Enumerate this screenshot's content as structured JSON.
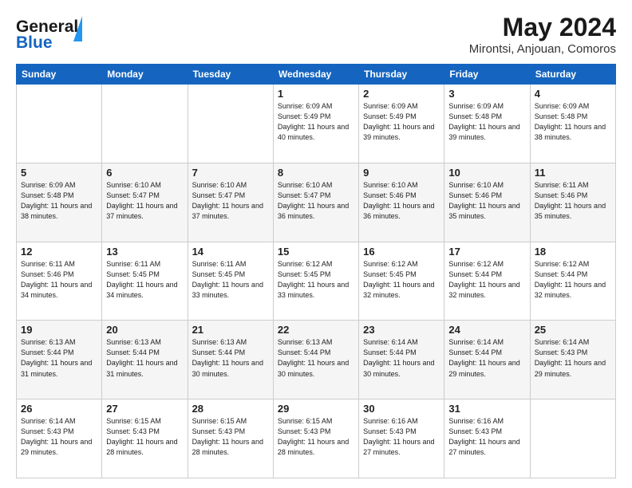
{
  "header": {
    "logo_line1": "General",
    "logo_line2": "Blue",
    "month": "May 2024",
    "location": "Mirontsi, Anjouan, Comoros"
  },
  "days_of_week": [
    "Sunday",
    "Monday",
    "Tuesday",
    "Wednesday",
    "Thursday",
    "Friday",
    "Saturday"
  ],
  "weeks": [
    [
      {
        "day": "",
        "info": ""
      },
      {
        "day": "",
        "info": ""
      },
      {
        "day": "",
        "info": ""
      },
      {
        "day": "1",
        "info": "Sunrise: 6:09 AM\nSunset: 5:49 PM\nDaylight: 11 hours\nand 40 minutes."
      },
      {
        "day": "2",
        "info": "Sunrise: 6:09 AM\nSunset: 5:49 PM\nDaylight: 11 hours\nand 39 minutes."
      },
      {
        "day": "3",
        "info": "Sunrise: 6:09 AM\nSunset: 5:48 PM\nDaylight: 11 hours\nand 39 minutes."
      },
      {
        "day": "4",
        "info": "Sunrise: 6:09 AM\nSunset: 5:48 PM\nDaylight: 11 hours\nand 38 minutes."
      }
    ],
    [
      {
        "day": "5",
        "info": "Sunrise: 6:09 AM\nSunset: 5:48 PM\nDaylight: 11 hours\nand 38 minutes."
      },
      {
        "day": "6",
        "info": "Sunrise: 6:10 AM\nSunset: 5:47 PM\nDaylight: 11 hours\nand 37 minutes."
      },
      {
        "day": "7",
        "info": "Sunrise: 6:10 AM\nSunset: 5:47 PM\nDaylight: 11 hours\nand 37 minutes."
      },
      {
        "day": "8",
        "info": "Sunrise: 6:10 AM\nSunset: 5:47 PM\nDaylight: 11 hours\nand 36 minutes."
      },
      {
        "day": "9",
        "info": "Sunrise: 6:10 AM\nSunset: 5:46 PM\nDaylight: 11 hours\nand 36 minutes."
      },
      {
        "day": "10",
        "info": "Sunrise: 6:10 AM\nSunset: 5:46 PM\nDaylight: 11 hours\nand 35 minutes."
      },
      {
        "day": "11",
        "info": "Sunrise: 6:11 AM\nSunset: 5:46 PM\nDaylight: 11 hours\nand 35 minutes."
      }
    ],
    [
      {
        "day": "12",
        "info": "Sunrise: 6:11 AM\nSunset: 5:46 PM\nDaylight: 11 hours\nand 34 minutes."
      },
      {
        "day": "13",
        "info": "Sunrise: 6:11 AM\nSunset: 5:45 PM\nDaylight: 11 hours\nand 34 minutes."
      },
      {
        "day": "14",
        "info": "Sunrise: 6:11 AM\nSunset: 5:45 PM\nDaylight: 11 hours\nand 33 minutes."
      },
      {
        "day": "15",
        "info": "Sunrise: 6:12 AM\nSunset: 5:45 PM\nDaylight: 11 hours\nand 33 minutes."
      },
      {
        "day": "16",
        "info": "Sunrise: 6:12 AM\nSunset: 5:45 PM\nDaylight: 11 hours\nand 32 minutes."
      },
      {
        "day": "17",
        "info": "Sunrise: 6:12 AM\nSunset: 5:44 PM\nDaylight: 11 hours\nand 32 minutes."
      },
      {
        "day": "18",
        "info": "Sunrise: 6:12 AM\nSunset: 5:44 PM\nDaylight: 11 hours\nand 32 minutes."
      }
    ],
    [
      {
        "day": "19",
        "info": "Sunrise: 6:13 AM\nSunset: 5:44 PM\nDaylight: 11 hours\nand 31 minutes."
      },
      {
        "day": "20",
        "info": "Sunrise: 6:13 AM\nSunset: 5:44 PM\nDaylight: 11 hours\nand 31 minutes."
      },
      {
        "day": "21",
        "info": "Sunrise: 6:13 AM\nSunset: 5:44 PM\nDaylight: 11 hours\nand 30 minutes."
      },
      {
        "day": "22",
        "info": "Sunrise: 6:13 AM\nSunset: 5:44 PM\nDaylight: 11 hours\nand 30 minutes."
      },
      {
        "day": "23",
        "info": "Sunrise: 6:14 AM\nSunset: 5:44 PM\nDaylight: 11 hours\nand 30 minutes."
      },
      {
        "day": "24",
        "info": "Sunrise: 6:14 AM\nSunset: 5:44 PM\nDaylight: 11 hours\nand 29 minutes."
      },
      {
        "day": "25",
        "info": "Sunrise: 6:14 AM\nSunset: 5:43 PM\nDaylight: 11 hours\nand 29 minutes."
      }
    ],
    [
      {
        "day": "26",
        "info": "Sunrise: 6:14 AM\nSunset: 5:43 PM\nDaylight: 11 hours\nand 29 minutes."
      },
      {
        "day": "27",
        "info": "Sunrise: 6:15 AM\nSunset: 5:43 PM\nDaylight: 11 hours\nand 28 minutes."
      },
      {
        "day": "28",
        "info": "Sunrise: 6:15 AM\nSunset: 5:43 PM\nDaylight: 11 hours\nand 28 minutes."
      },
      {
        "day": "29",
        "info": "Sunrise: 6:15 AM\nSunset: 5:43 PM\nDaylight: 11 hours\nand 28 minutes."
      },
      {
        "day": "30",
        "info": "Sunrise: 6:16 AM\nSunset: 5:43 PM\nDaylight: 11 hours\nand 27 minutes."
      },
      {
        "day": "31",
        "info": "Sunrise: 6:16 AM\nSunset: 5:43 PM\nDaylight: 11 hours\nand 27 minutes."
      },
      {
        "day": "",
        "info": ""
      }
    ]
  ]
}
